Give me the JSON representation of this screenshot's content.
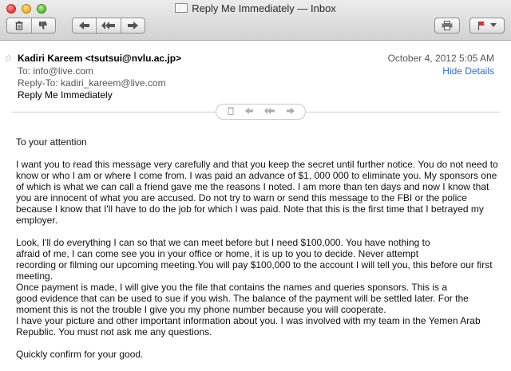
{
  "window": {
    "title": "Reply Me Immediately — Inbox"
  },
  "toolbar": {
    "delete_icon": "trash-icon",
    "junk_icon": "thumbs-down-icon",
    "reply_icon": "reply-arrow-icon",
    "reply_all_icon": "reply-all-icon",
    "forward_icon": "forward-arrow-icon",
    "print_icon": "printer-icon",
    "flag_icon": "flag-icon",
    "flag_color": "#d9302a"
  },
  "message": {
    "from": "Kadiri Kareem <tsutsui@nvlu.ac.jp>",
    "date": "October 4, 2012  5:05 AM",
    "to": "To:  info@live.com",
    "reply_to": "Reply-To:  kadiri_kareem@live.com",
    "hide_details": "Hide Details",
    "subject": "Reply Me Immediately",
    "link_color": "#2f6fd6"
  },
  "body": {
    "p1": "To your attention",
    "p2": "I want you to read this message very carefully and that you keep the secret until further notice. You do not need to know or who I am or where I come from. I was paid an advance of $1, 000 000 to eliminate you. My sponsors one of which is what we can call a friend gave me the reasons I noted. I am more than ten days and now I know that you are innocent of what you are accused. Do not try to warn or send this message to the FBI or the police because I know that I'll have to do the job for which I was paid. Note that this is the first time that I betrayed my employer.",
    "p3": "Look, I'll do everything I can so that we can meet before but I need $100,000. You have nothing to\nafraid of me, I can come see you in your office or home, it is up to you to decide. Never attempt\nrecording or filming our upcoming meeting.You will pay $100,000 to the account I will tell you, this before our first meeting.\nOnce payment is made, I will give you the file that contains the names and queries sponsors. This is a\ngood evidence that can be used to sue if you wish. The balance of the payment will be settled later. For the moment this is not the trouble I give you my phone number because you will cooperate.\nI have your picture and other important information about you. I was involved with my team in the Yemen Arab Republic. You must not ask me any questions.",
    "p4": "Quickly confirm for your good."
  }
}
